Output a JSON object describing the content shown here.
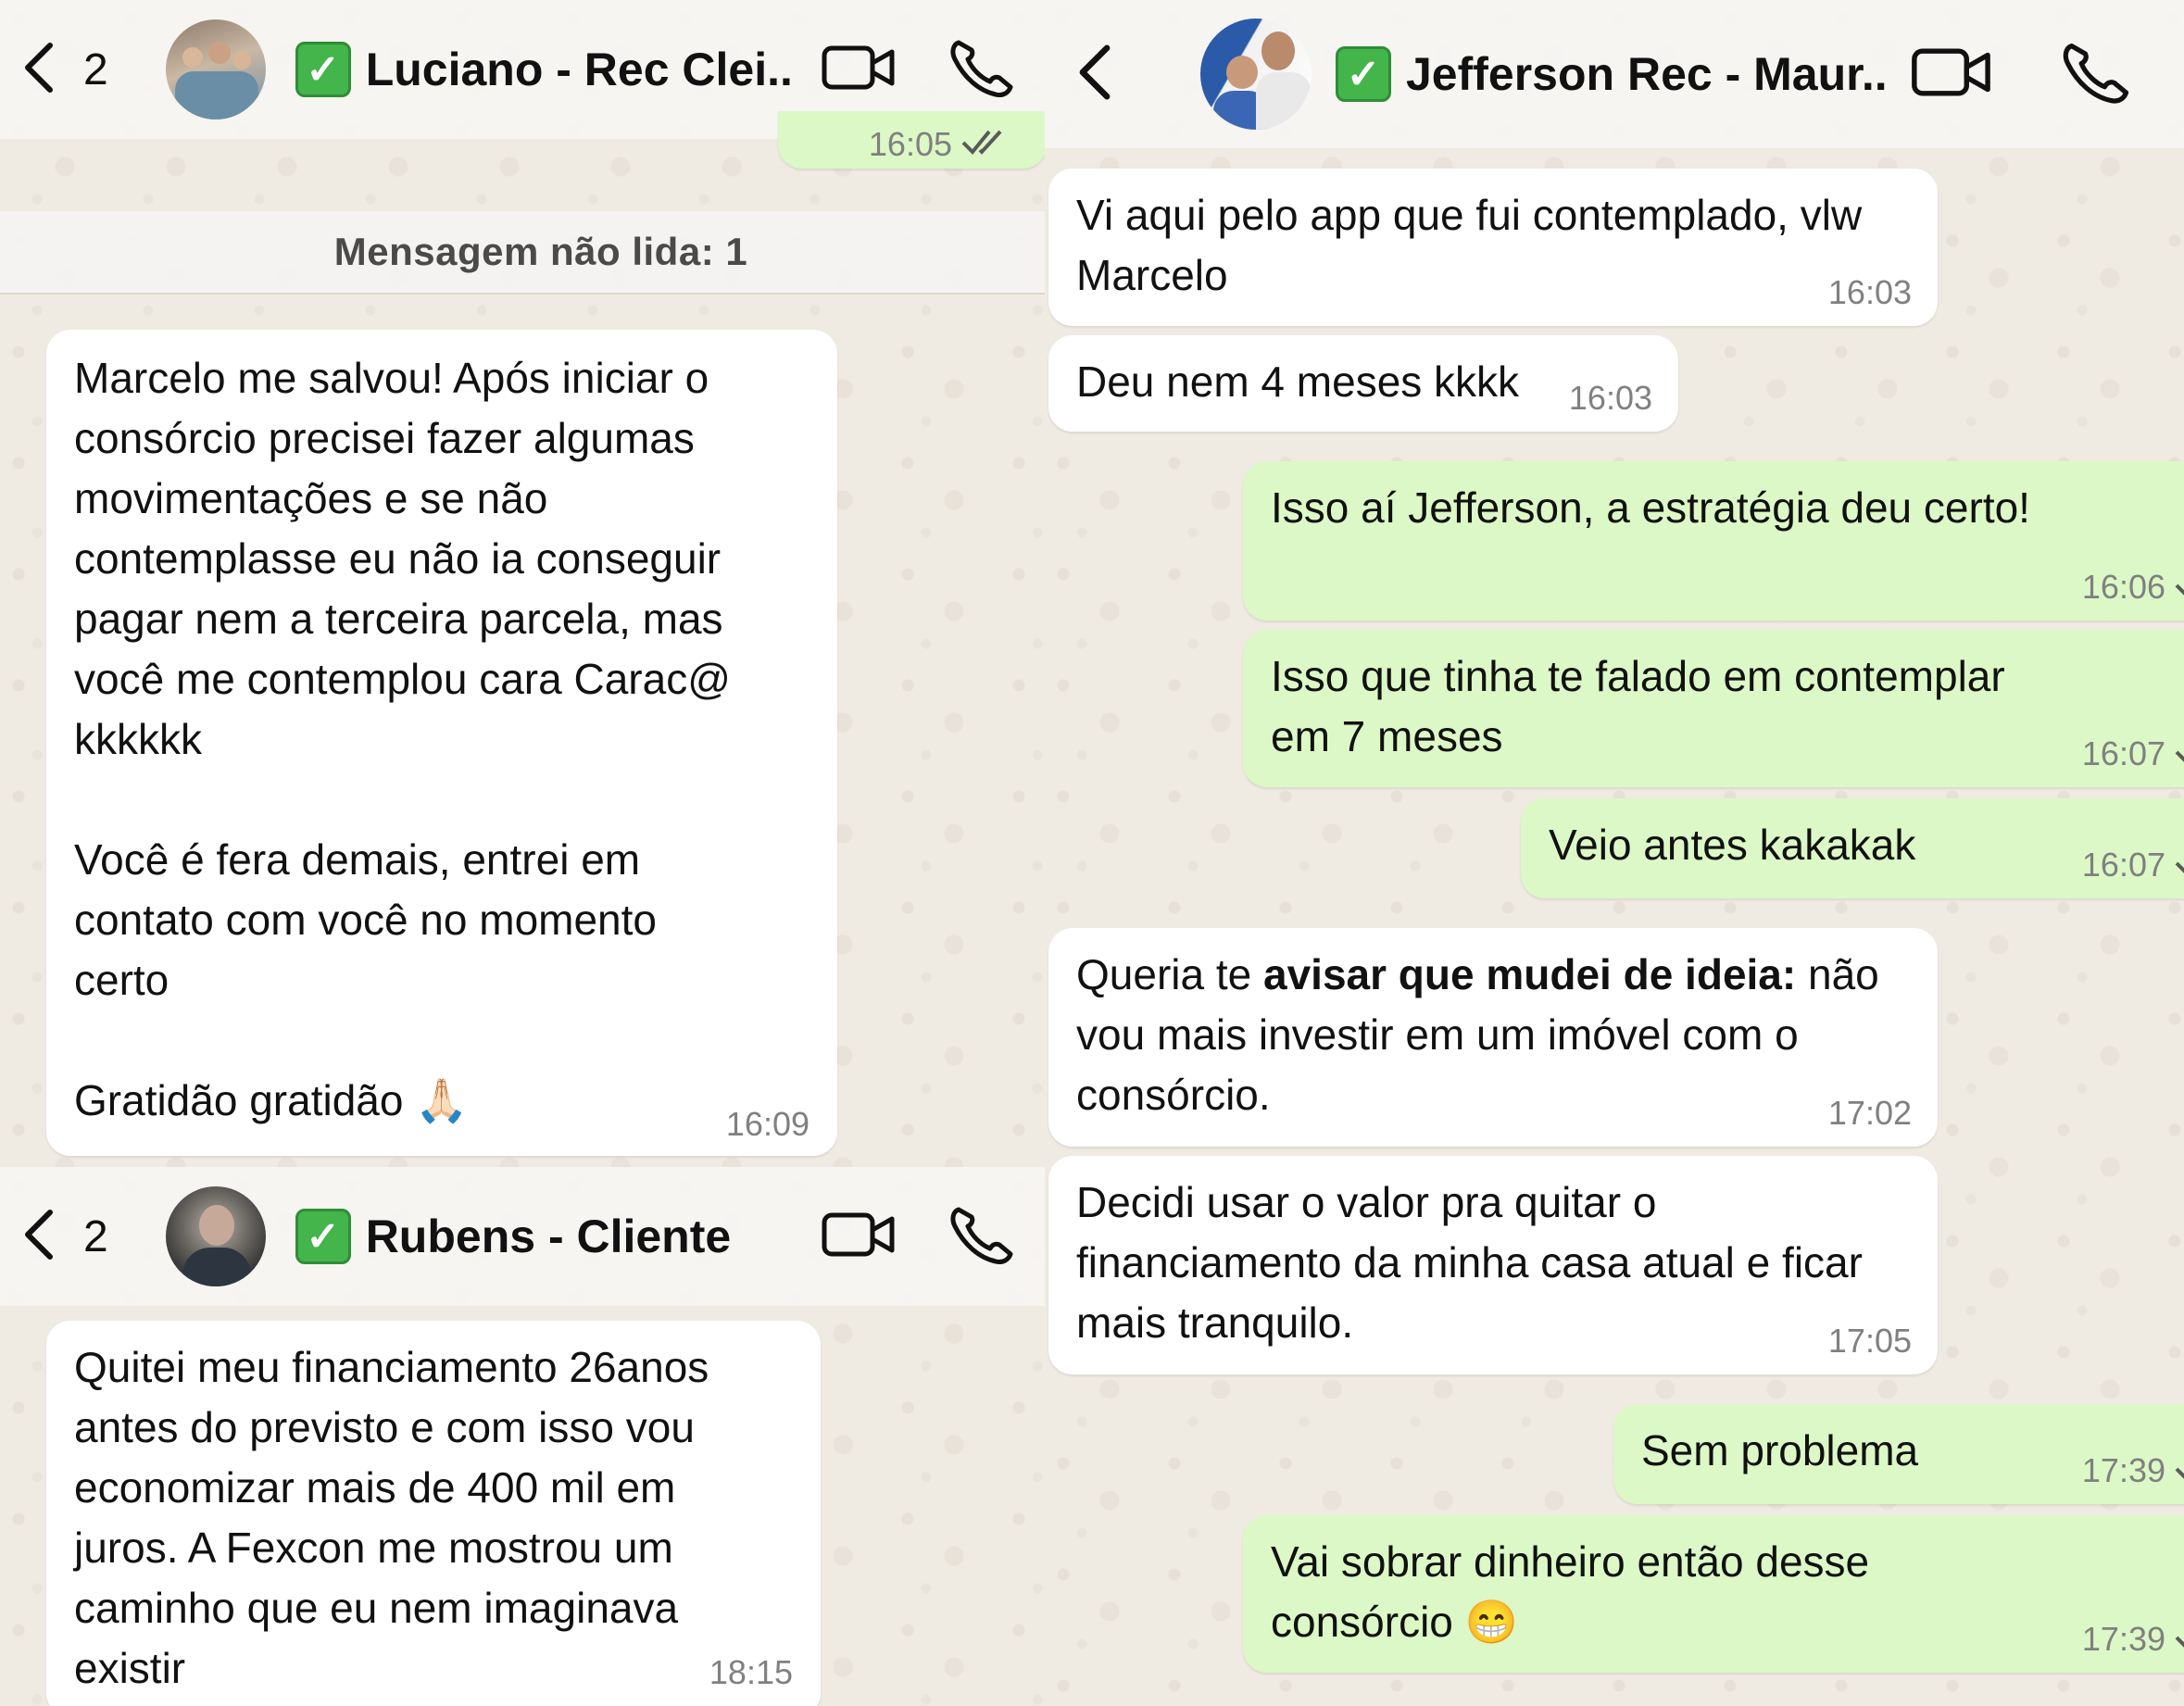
{
  "chat_luciano": {
    "back_count": "2",
    "contact_name": "Luciano - Rec Clei...",
    "unread_banner": "Mensagem não lida: 1",
    "peek_time": "16:05",
    "messages": [
      {
        "text": "Marcelo me salvou! Após iniciar o\nconsórcio precisei fazer algumas\nmovimentações e se não\ncontemplasse eu não ia conseguir\npagar nem a terceira parcela, mas\nvocê me contemplou cara Carac@\nkkkkkk\n\nVocê é fera demais, entrei em\ncontato com você no momento\ncerto\n\nGratidão gratidão 🙏🏻",
        "time": "16:09"
      }
    ]
  },
  "chat_rubens": {
    "back_count": "2",
    "contact_name": "Rubens - Cliente",
    "messages": [
      {
        "text": "Quitei meu financiamento 26anos\nantes do previsto e com isso vou\neconomizar mais de 400 mil em\njuros. A Fexcon me mostrou um\ncaminho que eu nem imaginava\nexistir",
        "time": "18:15"
      }
    ]
  },
  "chat_jefferson": {
    "contact_name": "Jefferson Rec - Maur...",
    "messages": [
      {
        "direction": "in",
        "text": "Vi aqui pelo app que fui contemplado, vlw\nMarcelo",
        "time": "16:03"
      },
      {
        "direction": "in",
        "text": "Deu nem 4 meses kkkk",
        "time": "16:03"
      },
      {
        "direction": "out",
        "text": "Isso aí Jefferson, a estratégia deu certo!",
        "time": "16:06"
      },
      {
        "direction": "out",
        "text": "Isso que tinha te falado em contemplar\nem 7 meses",
        "time": "16:07"
      },
      {
        "direction": "out",
        "text": "Veio antes kakakak",
        "time": "16:07"
      },
      {
        "direction": "in",
        "text_before": "Queria te ",
        "text_bold": "avisar que mudei de ideia:",
        "text_after": " não\nvou mais investir em um imóvel com o\nconsórcio.",
        "time": "17:02"
      },
      {
        "direction": "in",
        "text": "Decidi usar o valor pra quitar o\nfinanciamento da minha casa atual e ficar\nmais tranquilo.",
        "time": "17:05"
      },
      {
        "direction": "out",
        "text": "Sem problema",
        "time": "17:39"
      },
      {
        "direction": "out",
        "text": "Vai sobrar dinheiro então desse\nconsórcio 😁",
        "time": "17:39"
      }
    ]
  },
  "colors": {
    "incoming_bubble": "#ffffff",
    "outgoing_bubble": "#dcf8c6",
    "verified_check": "#43b54a",
    "wallpaper": "#efeae2"
  },
  "icons": [
    "chevron-left-icon",
    "video-call-icon",
    "phone-icon",
    "verified-check-icon",
    "double-check-icon"
  ]
}
